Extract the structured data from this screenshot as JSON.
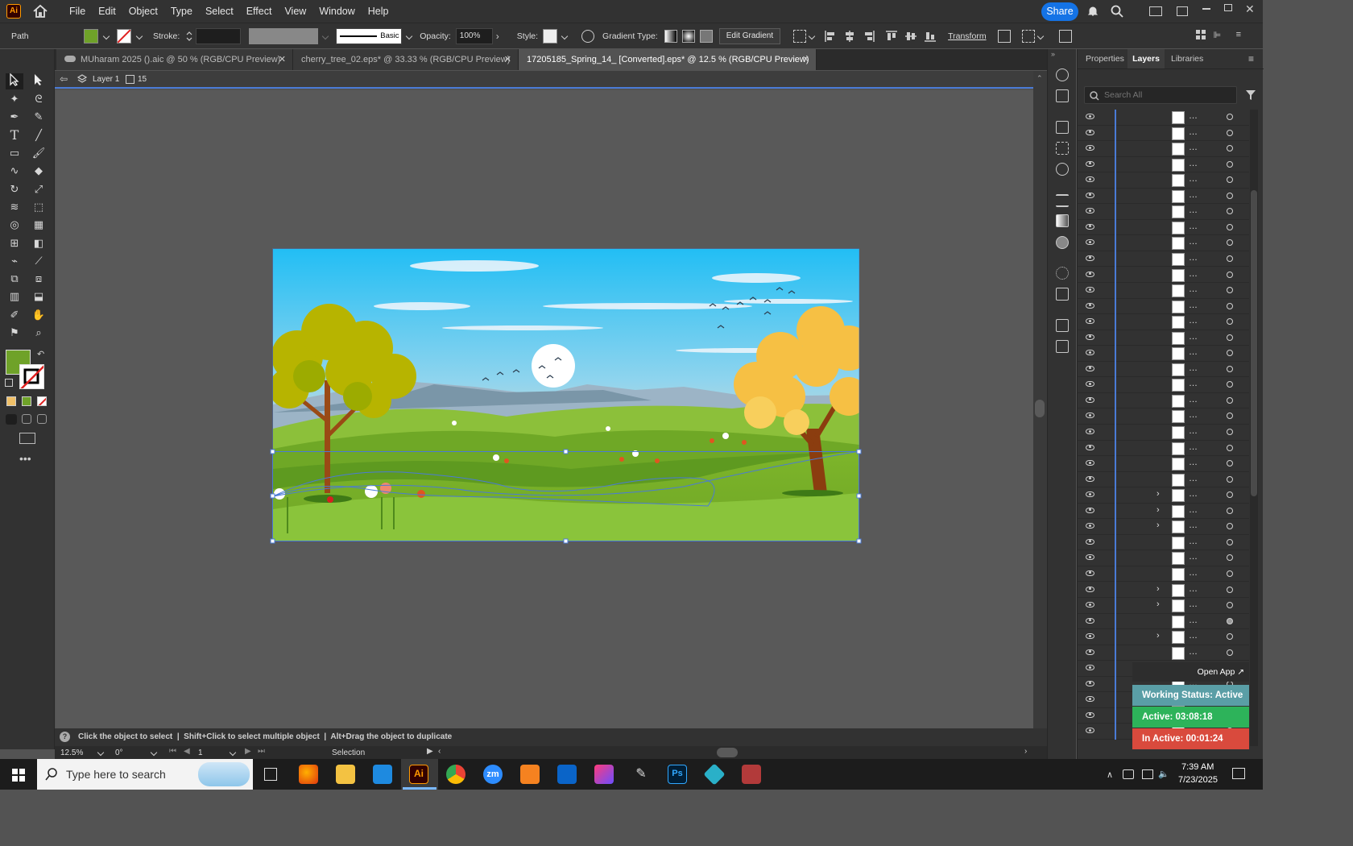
{
  "menubar": {
    "app_logo": "Ai",
    "items": [
      "File",
      "Edit",
      "Object",
      "Type",
      "Select",
      "Effect",
      "View",
      "Window",
      "Help"
    ],
    "share_label": "Share"
  },
  "control_bar": {
    "selection_type": "Path",
    "stroke_label": "Stroke:",
    "brush_label": "Basic",
    "opacity_label": "Opacity:",
    "opacity_value": "100%",
    "style_label": "Style:",
    "gradient_type_label": "Gradient Type:",
    "edit_gradient_label": "Edit Gradient",
    "transform_label": "Transform",
    "fill_color": "#6fa229"
  },
  "tabs": [
    {
      "label": "MUharam 2025 ().aic @ 50 % (RGB/CPU Preview)",
      "active": false
    },
    {
      "label": "cherry_tree_02.eps* @ 33.33 % (RGB/CPU Preview)",
      "active": false
    },
    {
      "label": "17205185_Spring_14_ [Converted].eps* @ 12.5 % (RGB/CPU Preview)",
      "active": true
    }
  ],
  "breadcrumb": {
    "layer_name": "Layer 1",
    "count": "15"
  },
  "status": {
    "hint": "Click the object to select  |  Shift+Click to select multiple object  |  Alt+Drag the object to duplicate",
    "zoom": "12.5%",
    "rotation": "0°",
    "artboard": "1",
    "tool_name": "Selection"
  },
  "panel": {
    "tabs": [
      "Properties",
      "Layers",
      "Libraries"
    ],
    "active_tab": "Layers",
    "search_placeholder": "Search All"
  },
  "tracker": {
    "open_app_label": "Open App ↗",
    "working_status": "Working Status: Active",
    "active_time": "Active: 03:08:18",
    "inactive_time": "In Active: 00:01:24"
  },
  "taskbar": {
    "search_placeholder": "Type here to search",
    "time": "7:39 AM",
    "date": "7/23/2025"
  }
}
